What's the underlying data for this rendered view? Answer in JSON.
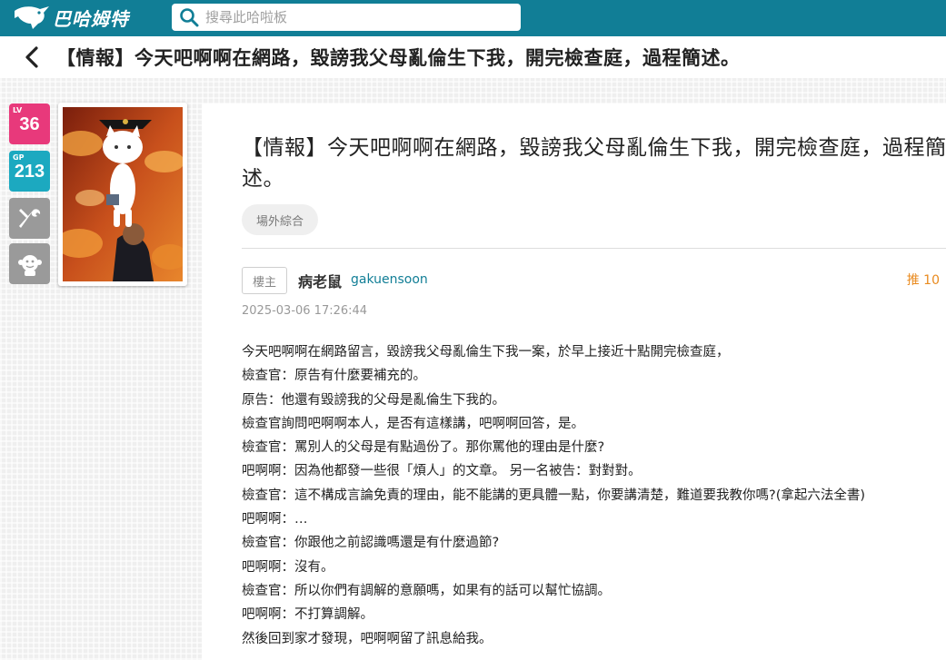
{
  "site": {
    "logo_text": "巴哈姆特",
    "search_placeholder": "搜尋此哈啦板"
  },
  "header": {
    "title": "【情報】今天吧啊啊在網路，毀謗我父母亂倫生下我，開完檢查庭，過程簡述。"
  },
  "sidebar": {
    "level_label": "LV",
    "level": "36",
    "gp_label": "GP",
    "gp": "213"
  },
  "post": {
    "title": "【情報】今天吧啊啊在網路，毀謗我父母亂倫生下我，開完檢查庭，過程簡述。",
    "tag": "場外綜合",
    "floor_label": "樓主",
    "author_name": "病老鼠",
    "author_id": "gakuensoon",
    "push": "推 10",
    "time": "2025-03-06 17:26:44",
    "lines": [
      "今天吧啊啊在網路留言，毀謗我父母亂倫生下我一案，於早上接近十點開完檢查庭，",
      "檢查官：原告有什麼要補充的。",
      "原告：他還有毀謗我的父母是亂倫生下我的。",
      "檢查官詢問吧啊啊本人，是否有這樣講，吧啊啊回答，是。",
      "檢查官：罵別人的父母是有點過份了。那你罵他的理由是什麼?",
      "吧啊啊：因為他都發一些很「煩人」的文章。 另一名被告：對對對。",
      "檢查官：這不構成言論免責的理由，能不能講的更具體一點，你要講清楚，難道要我教你嗎?(拿起六法全書)",
      "吧啊啊：…",
      "檢查官：你跟他之前認識嗎還是有什麼過節?",
      "吧啊啊：沒有。",
      "檢查官：所以你們有調解的意願嗎，如果有的話可以幫忙協調。",
      "吧啊啊：不打算調解。",
      "然後回到家才發現，吧啊啊留了訊息給我。"
    ]
  },
  "colors": {
    "topbar": "#117e96",
    "level_badge": "#e8397b",
    "gp_badge": "#1ca9c0",
    "push": "#e98a1e"
  }
}
